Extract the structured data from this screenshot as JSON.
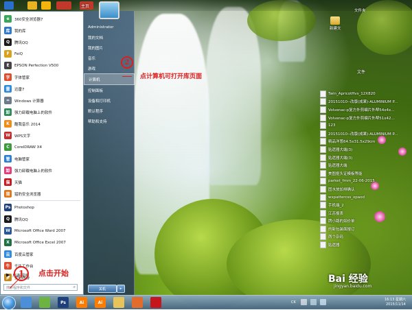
{
  "top_bar": {
    "items": [
      {
        "label": "Ir",
        "color": "#2a6fc9"
      },
      {
        "label": "",
        "color": "#e6b422"
      },
      {
        "label": "",
        "color": "#f2b40d"
      },
      {
        "label": "Ieth",
        "color": "#c0392b"
      },
      {
        "label": "",
        "color": "#3c8f2f"
      },
      {
        "label": "主页",
        "color": "#c0392b"
      },
      {
        "label": "",
        "color": "#6a5acd"
      },
      {
        "label": "",
        "color": "#2b78c7"
      }
    ]
  },
  "start_menu": {
    "programs": [
      {
        "label": "360安全浏览器7",
        "icon": "360-browser-icon",
        "color": "#3aa657",
        "glyph": "e"
      },
      {
        "label": "我的库",
        "icon": "library-icon",
        "color": "#2c79c9",
        "glyph": "库"
      },
      {
        "label": "腾讯QQ",
        "icon": "qq-icon",
        "color": "#1a1a1a",
        "glyph": "Q"
      },
      {
        "label": "FeiQ",
        "icon": "feiq-icon",
        "color": "#d9a21c",
        "glyph": "F"
      },
      {
        "label": "EPSON Perfection V500",
        "icon": "epson-icon",
        "color": "#444",
        "glyph": "E"
      },
      {
        "label": "字体管家",
        "icon": "font-manager-icon",
        "color": "#e04b2e",
        "glyph": "字"
      },
      {
        "label": "迅雷7",
        "icon": "xunlei-icon",
        "color": "#2e8be0",
        "glyph": "雷"
      },
      {
        "label": "Windows 计算器",
        "icon": "calculator-icon",
        "color": "#6c7a89",
        "glyph": "="
      },
      {
        "label": "强力卸载电脑上的软件",
        "icon": "uninstall-icon",
        "color": "#2e8b57",
        "glyph": "卸"
      },
      {
        "label": "酷我音乐 2014",
        "icon": "kuwo-icon",
        "color": "#f08c1a",
        "glyph": "K"
      },
      {
        "label": "WPS文字",
        "icon": "wps-icon",
        "color": "#c72e2e",
        "glyph": "W"
      },
      {
        "label": "CorelDRAW X4",
        "icon": "coreldraw-icon",
        "color": "#3c9b3c",
        "glyph": "C"
      },
      {
        "label": "电脑管家",
        "icon": "pc-manager-icon",
        "color": "#2d7fd3",
        "glyph": "管"
      },
      {
        "label": "强力卸载电脑上的软件",
        "icon": "uninstall-icon-2",
        "color": "#e23b79",
        "glyph": "卸"
      },
      {
        "label": "天猫",
        "icon": "tmall-icon",
        "color": "#c4161c",
        "glyph": "猫"
      },
      {
        "label": "猎豹安全浏览器",
        "icon": "liebao-icon",
        "color": "#e0751a",
        "glyph": "猎"
      },
      {
        "label": "Photoshop",
        "icon": "photoshop-icon",
        "color": "#1d3f7a",
        "glyph": "Ps"
      },
      {
        "label": "腾讯QQ",
        "icon": "qq-icon-2",
        "color": "#1a1a1a",
        "glyph": "Q"
      },
      {
        "label": "Microsoft Office Word 2007",
        "icon": "word-icon",
        "color": "#2b5797",
        "glyph": "W"
      },
      {
        "label": "Microsoft Office Excel 2007",
        "icon": "excel-icon",
        "color": "#1e7145",
        "glyph": "X"
      },
      {
        "label": "百度云管家",
        "icon": "baidu-cloud-icon",
        "color": "#2e8be0",
        "glyph": "云"
      },
      {
        "label": "千牛工作台",
        "icon": "qianniu-icon",
        "color": "#e04b2e",
        "glyph": "牛"
      },
      {
        "label": "梦幻西游",
        "icon": "mhxy-icon",
        "color": "#c88a1e",
        "glyph": "梦"
      }
    ],
    "all_programs": "所有程序",
    "search_placeholder": "搜索程序和文件",
    "right_items": [
      {
        "label": "Administrator"
      },
      {
        "label": "我的文档"
      },
      {
        "label": "我的图片"
      },
      {
        "label": "音乐"
      },
      {
        "label": "游戏"
      },
      {
        "label": "计算机",
        "highlight": true
      },
      {
        "label": "控制面板"
      },
      {
        "label": "设备和打印机"
      },
      {
        "label": "默认程序"
      },
      {
        "label": "帮助和支持"
      }
    ],
    "shutdown_label": "关机"
  },
  "annotations": {
    "step1_number": "1",
    "step1_text": "点击开始",
    "step2_number": "2",
    "step2_text": "点计算机可打开库页面"
  },
  "desktop": {
    "folder_label_top": "文件夹",
    "folder_label": "新建文",
    "doc_title": "文件",
    "docs": [
      "Twin_ApricotHvs_12X820",
      "20151010--改版(成果)-ALUMINIUM P...",
      "Volvenac-p复方外剪编片外帮54x4x...",
      "Volvenac-p复方外剪编片外帮51x42...",
      "123",
      "20151010--改版(成果)-ALUMINIUM P...",
      "精品洋葱64.5x31.5x29cm",
      "贴遗器大端(3)",
      "贴遗器大端(3)",
      "贴遗器大端",
      "美图抠头证模板等能",
      "parket_fmm_22-06-2015",
      "固水放加排确认",
      "wxpattercss_xpaod",
      "手机端_2",
      "江苏报表",
      "牌小路的如价单",
      "的新包装面报订",
      "两个杂码",
      "贴遗器"
    ]
  },
  "taskbar": {
    "apps": [
      {
        "label": "",
        "color": "#4a8fd8",
        "icon": "ie-icon"
      },
      {
        "label": "",
        "color": "#6db33f",
        "icon": "chrome-like-icon"
      },
      {
        "label": "Ps",
        "color": "#1d3f7a",
        "icon": "photoshop-taskbar-icon"
      },
      {
        "label": "Ai",
        "color": "#ff7c00",
        "icon": "illustrator-taskbar-icon"
      },
      {
        "label": "Ai",
        "color": "#ff7c00",
        "icon": "illustrator-taskbar-icon-2"
      },
      {
        "label": "",
        "color": "#e8c35a",
        "icon": "folder-taskbar-icon"
      },
      {
        "label": "",
        "color": "#e36b2c",
        "icon": "firefox-like-icon"
      },
      {
        "label": "",
        "color": "#c4161c",
        "icon": "wps-taskbar-icon"
      }
    ],
    "tray_lang": "CK",
    "time": "16:13 星期六",
    "date": "2015/11/14"
  },
  "watermark": {
    "text": "Bai 经验",
    "url": "jingyan.baidu.com"
  }
}
